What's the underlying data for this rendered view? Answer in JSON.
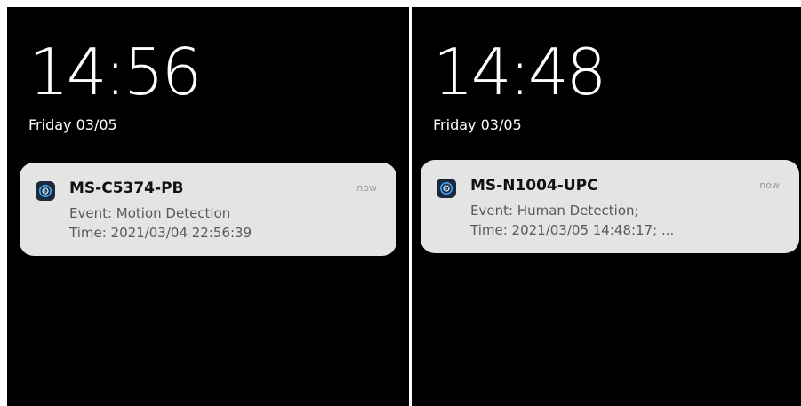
{
  "screens": [
    {
      "clock": "14:56",
      "date": "Friday 03/05",
      "notification": {
        "app_icon": "camera-app-icon",
        "title": "MS-C5374-PB",
        "time": "now",
        "event": "Event: Motion Detection",
        "detail": "Time: 2021/03/04 22:56:39"
      }
    },
    {
      "clock": "14:48",
      "date": "Friday 03/05",
      "notification": {
        "app_icon": "camera-app-icon",
        "title": "MS-N1004-UPC",
        "time": "now",
        "event": "Event: Human Detection;",
        "detail": "Time: 2021/03/05 14:48:17; ..."
      }
    }
  ],
  "colors": {
    "background": "#000000",
    "card": "#e4e4e4",
    "icon_bg": "#1b2a3a",
    "icon_accent": "#3fa8ff"
  }
}
